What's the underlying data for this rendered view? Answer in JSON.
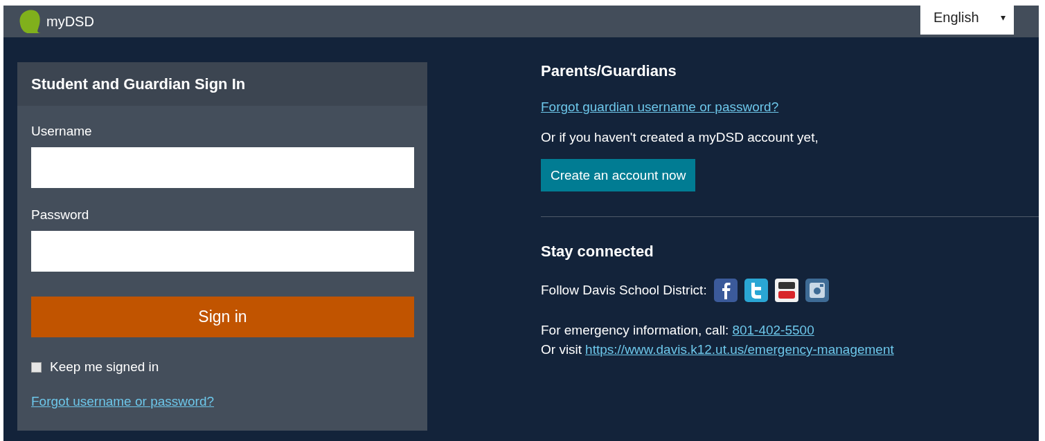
{
  "topbar": {
    "logo_text": "myDSD",
    "language": "English",
    "language_caret": "▾"
  },
  "signin": {
    "title": "Student and Guardian Sign In",
    "username": {
      "label": "Username"
    },
    "password": {
      "label": "Password"
    },
    "submit": "Sign in",
    "keep_signed_in": {
      "label": "Keep me signed in",
      "checked": false
    },
    "forgot_link": "Forgot username or password?"
  },
  "parents": {
    "title": "Parents/Guardians",
    "forgot_link": "Forgot guardian username or password?",
    "note": "Or if you haven't created a myDSD account yet,",
    "create_button": "Create an account now"
  },
  "connected": {
    "title": "Stay connected",
    "follow_label": "Follow Davis School District:",
    "social": [
      {
        "kind": "facebook"
      },
      {
        "kind": "twitter"
      },
      {
        "kind": "youtube"
      },
      {
        "kind": "instagram"
      }
    ],
    "emergency_text": "For emergency information, call:",
    "emergency_phone": "801-402-5500",
    "visit_text": "Or visit",
    "visit_link": "https://www.davis.k12.ut.us/emergency-management"
  }
}
